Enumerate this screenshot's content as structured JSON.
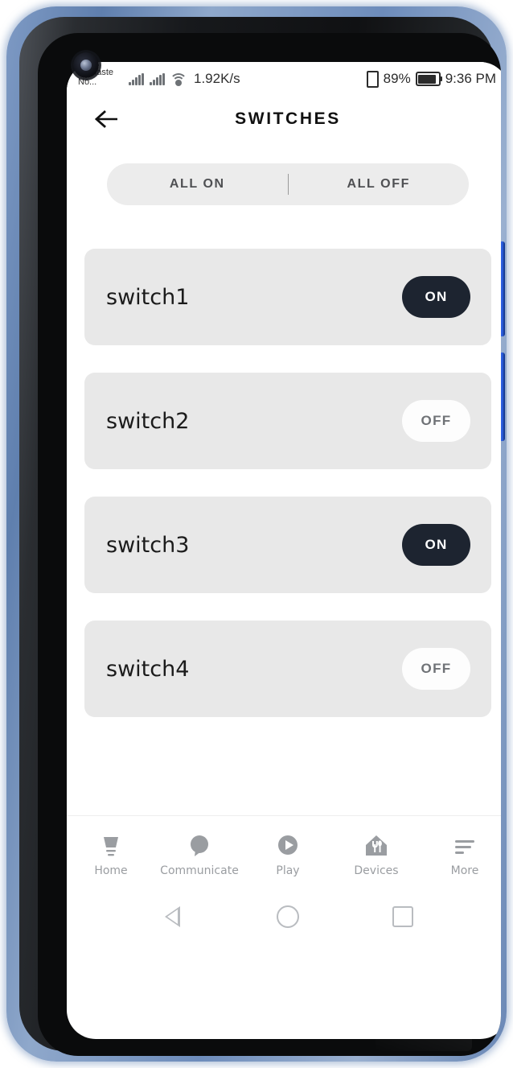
{
  "status_bar": {
    "carrier": "Namaste\nNo...",
    "signal_icon_1": "cellular-signal-icon",
    "signal_icon_2": "cellular-signal-icon",
    "wifi_icon": "wifi-icon",
    "network_speed": "1.92K/s",
    "vibrate_icon": "vibrate-icon",
    "battery_percent": "89%",
    "battery_icon": "battery-icon",
    "time": "9:36 PM"
  },
  "header": {
    "back_icon": "arrow-left-icon",
    "title": "SWITCHES"
  },
  "all_toggle": {
    "all_on_label": "ALL ON",
    "all_off_label": "ALL OFF"
  },
  "switches": [
    {
      "name": "switch1",
      "state": "ON",
      "state_class": "on"
    },
    {
      "name": "switch2",
      "state": "OFF",
      "state_class": "off"
    },
    {
      "name": "switch3",
      "state": "ON",
      "state_class": "on"
    },
    {
      "name": "switch4",
      "state": "OFF",
      "state_class": "off"
    }
  ],
  "bottom_nav": [
    {
      "label": "Home",
      "icon": "lamp-icon"
    },
    {
      "label": "Communicate",
      "icon": "speech-bubble-icon"
    },
    {
      "label": "Play",
      "icon": "play-circle-icon"
    },
    {
      "label": "Devices",
      "icon": "house-utensils-icon"
    },
    {
      "label": "More",
      "icon": "menu-lines-icon"
    }
  ],
  "system_nav": {
    "back": "back-triangle-icon",
    "home": "home-circle-icon",
    "recents": "recents-square-icon"
  },
  "colors": {
    "accent_on": "#1d2430",
    "card_bg": "#e8e8e8",
    "pill_bg": "#ececec",
    "nav_label": "#9a9da1"
  }
}
